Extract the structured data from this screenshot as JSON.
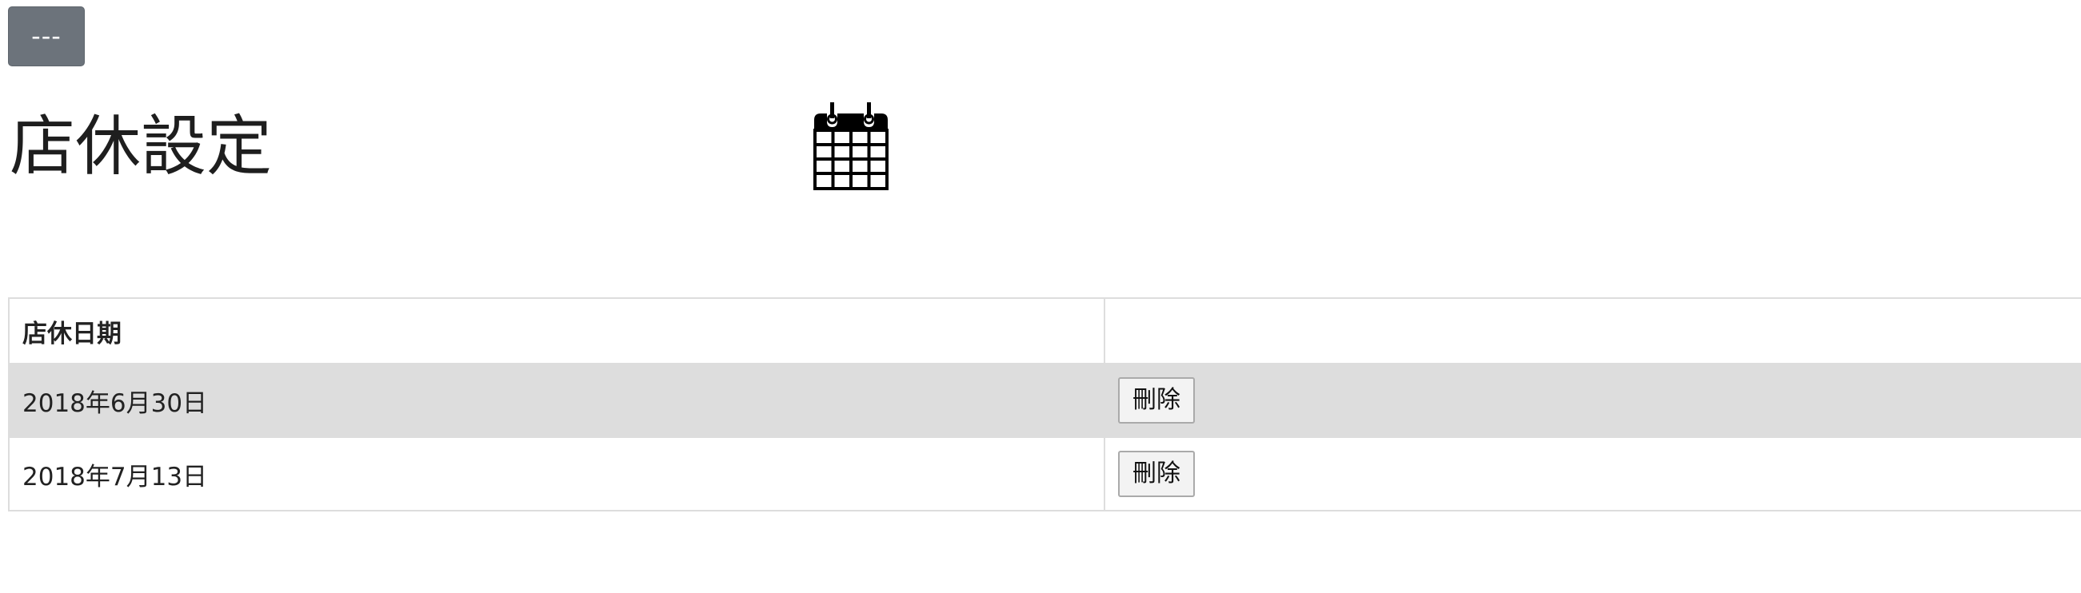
{
  "header": {
    "menu_button_label": "---",
    "title": "店休設定",
    "calendar_icon": "calendar-icon"
  },
  "table": {
    "columns": [
      "店休日期",
      ""
    ],
    "rows": [
      {
        "date": "2018年6月30日",
        "action_label": "刪除"
      },
      {
        "date": "2018年7月13日",
        "action_label": "刪除"
      }
    ]
  },
  "colors": {
    "menu_button_bg": "#6c737b",
    "striped_row_bg": "#dddddd",
    "border": "#dddddd"
  }
}
